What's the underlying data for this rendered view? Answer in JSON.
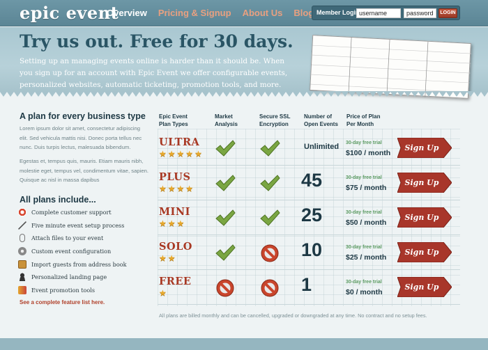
{
  "header": {
    "logo": "epic event",
    "nav": [
      {
        "label": "Overview"
      },
      {
        "label": "Pricing & Signup"
      },
      {
        "label": "About Us"
      },
      {
        "label": "Blog"
      }
    ],
    "login": {
      "label": "Member Login",
      "username_value": "username",
      "password_value": "password",
      "button": "LOGIN"
    }
  },
  "hero": {
    "title": "Try us out. Free for 30 days.",
    "body": "Setting up an managing events online is harder than it should be. When you sign up for an account with Epic Event we offer configurable events, personalized websites, automatic ticketing, promotion tools, and more."
  },
  "left": {
    "title": "A plan for every business type",
    "para1": "Lorem ipsum dolor sit amet, consectetur adipiscing elit. Sed vehicula mattis nisi. Donec porta tellus nec nunc. Duis turpis lectus, malesuada bibendum.",
    "para2": "Egestas et, tempus quis, mauris. Etiam mauris nibh, molestie eget, tempus vel, condimentum vitae, sapien. Quisque ac nisl in massa dapibus",
    "includes_title": "All plans include...",
    "features": [
      {
        "label": "Complete customer support",
        "icon": "lifebuoy-icon"
      },
      {
        "label": "Five minute event setup process",
        "icon": "wand-icon"
      },
      {
        "label": "Attach files to your event",
        "icon": "paperclip-icon"
      },
      {
        "label": "Custom event configuration",
        "icon": "gear-icon"
      },
      {
        "label": "Import guests from address book",
        "icon": "address-book-icon"
      },
      {
        "label": "Personalized landing page",
        "icon": "user-icon"
      },
      {
        "label": "Event promotion tools",
        "icon": "megaphone-icon"
      }
    ],
    "feature_link": "See a complete feature list here."
  },
  "table": {
    "headers": {
      "plan": "Epic Event\nPlan Types",
      "market": "Market\nAnalysis",
      "ssl": "Secure SSL\nEncryption",
      "events": "Number of\nOpen Events",
      "price": "Price of Plan\nPer Month"
    },
    "rows": [
      {
        "name": "ULTRA",
        "stars": 5,
        "market": true,
        "ssl": true,
        "events": "Unlimited",
        "trial": "30-day free trial",
        "price": "$100 / month",
        "cta": "Sign Up"
      },
      {
        "name": "PLUS",
        "stars": 4,
        "market": true,
        "ssl": true,
        "events": "45",
        "trial": "30-day free trial",
        "price": "$75 / month",
        "cta": "Sign Up"
      },
      {
        "name": "MINI",
        "stars": 3,
        "market": true,
        "ssl": true,
        "events": "25",
        "trial": "30-day free trial",
        "price": "$50 / month",
        "cta": "Sign Up"
      },
      {
        "name": "SOLO",
        "stars": 2,
        "market": true,
        "ssl": false,
        "events": "10",
        "trial": "30-day free trial",
        "price": "$25 / month",
        "cta": "Sign Up"
      },
      {
        "name": "FREE",
        "stars": 1,
        "market": false,
        "ssl": false,
        "events": "1",
        "trial": "30-day free trial",
        "price": "$0 / month",
        "cta": "Sign Up"
      }
    ],
    "footnote": "All plans are billed monthly and can be cancelled, upgraded or downgraded at any time. No contract and no setup fees."
  },
  "colors": {
    "accent_red": "#a83823",
    "check_green": "#6e9a3c",
    "heading_dark": "#1d3844"
  }
}
